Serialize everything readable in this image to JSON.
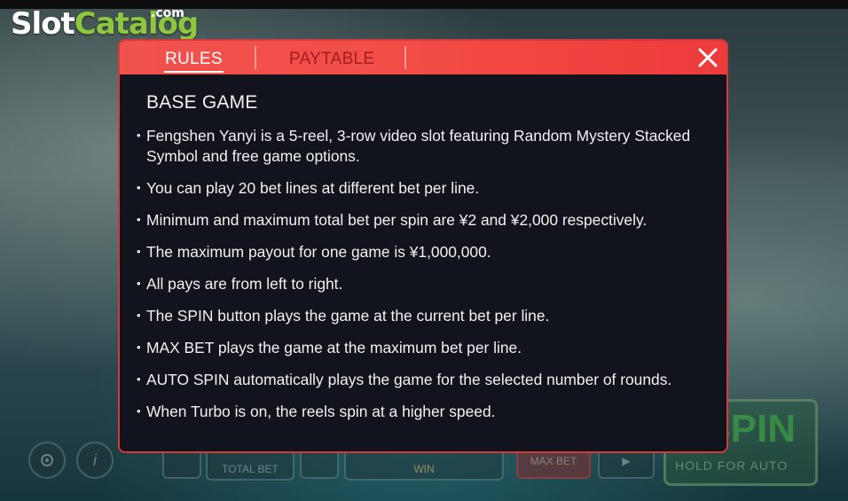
{
  "background": {
    "title_glyphs": "",
    "controls": {
      "total_bet_label": "TOTAL BET",
      "win_label": "WIN",
      "max_bet_label": "MAX BET",
      "spin_label": "SPIN",
      "hold_label": "HOLD FOR AUTO"
    }
  },
  "logo": {
    "slot": "Slot",
    "catalog": "Catalog",
    "com": ".com"
  },
  "modal": {
    "tabs": [
      {
        "label": "RULES",
        "active": true
      },
      {
        "label": "PAYTABLE",
        "active": false
      }
    ],
    "close_icon": "close-icon",
    "section_title": "BASE GAME",
    "rules": [
      "Fengshen Yanyi is a  5-reel, 3-row video slot featuring Random Mystery Stacked Symbol and free game options.",
      "You can play 20 bet lines at different bet per line.",
      "Minimum and maximum total bet per spin are ¥2 and ¥2,000 respectively.",
      "The maximum payout for one game is  ¥1,000,000.",
      "All pays are from left to right.",
      "The SPIN button plays the game at the current bet per line.",
      "MAX BET plays the game at the maximum bet per line.",
      "AUTO SPIN automatically plays the game for the selected number of rounds.",
      "When Turbo is on, the reels spin at a higher speed."
    ]
  },
  "colors": {
    "header_red": "#f34d47",
    "modal_bg": "#11131d",
    "logo_green": "#8ec63f",
    "inactive_tab": "#a21d22"
  }
}
